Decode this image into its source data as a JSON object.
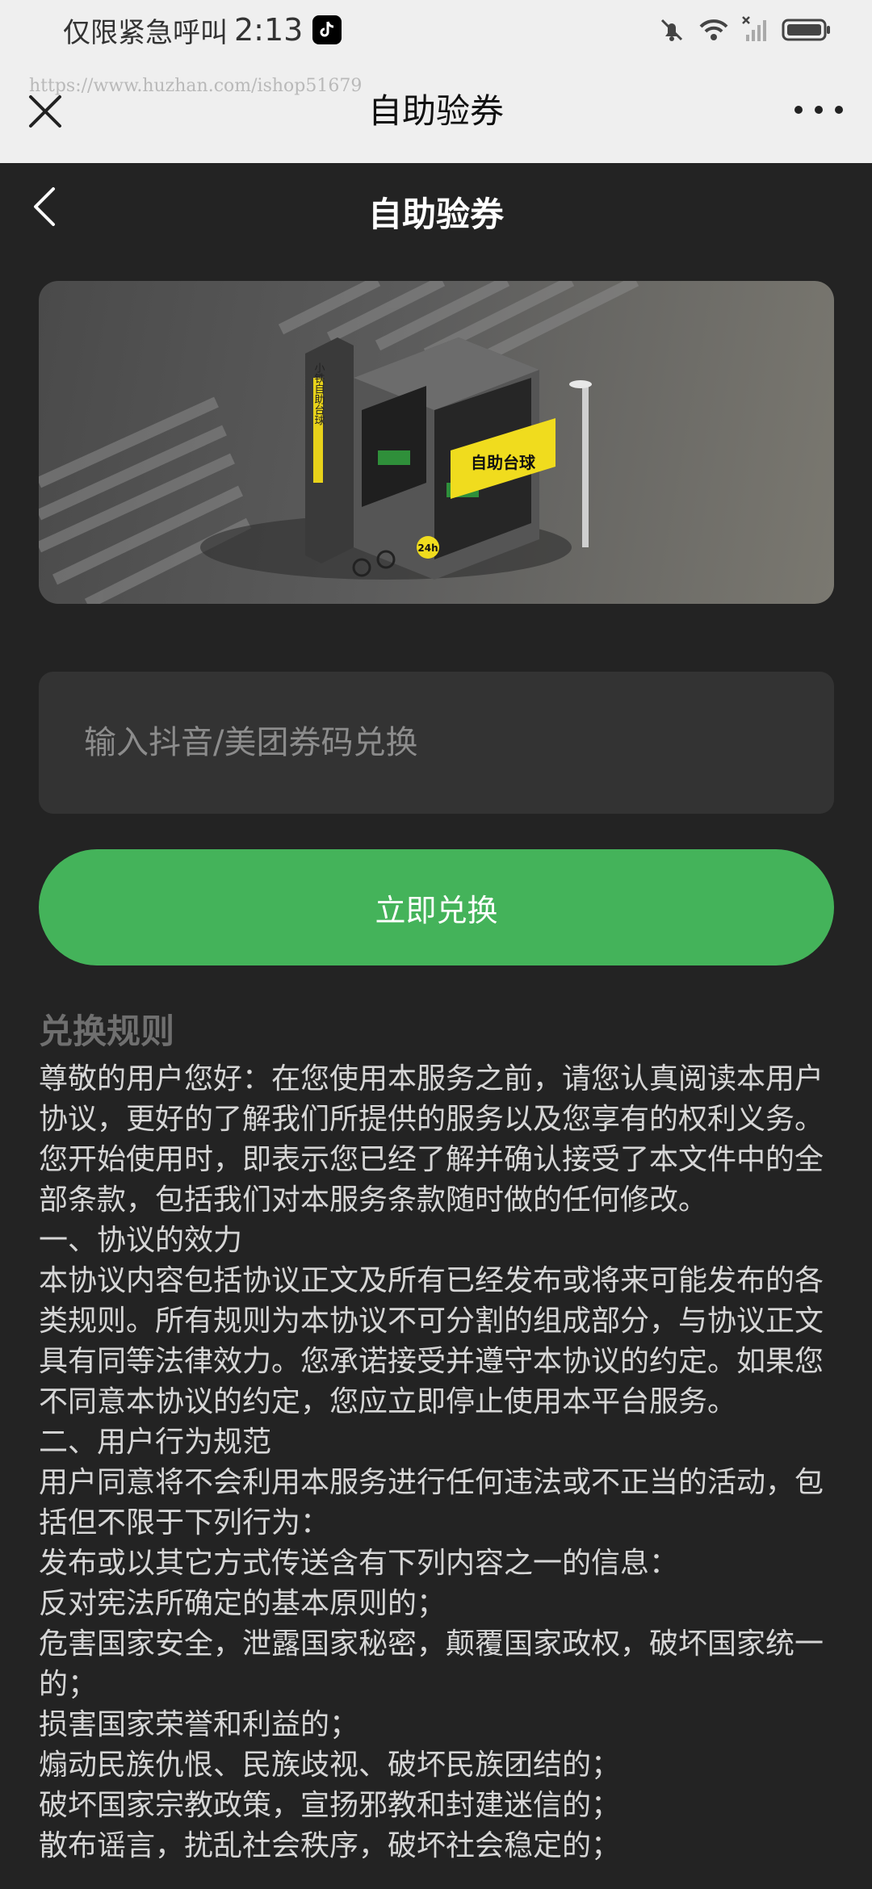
{
  "status_bar": {
    "carrier": "仅限紧急呼叫",
    "time": "2:13"
  },
  "wechat": {
    "watermark": "https://www.huzhan.com/ishop51679",
    "title": "自助验券"
  },
  "header": {
    "title": "自助验券"
  },
  "banner": {
    "sign_text": "自助台球",
    "vertical_text": "小铁自助台球",
    "badge_text": "24h"
  },
  "redeem": {
    "placeholder": "输入抖音/美团券码兑换",
    "button_label": "立即兑换"
  },
  "rules": {
    "title": "兑换规则",
    "lines": [
      "尊敬的用户您好：在您使用本服务之前，请您认真阅读本用户协议，更好的了解我们所提供的服务以及您享有的权利义务。您开始使用时，即表示您已经了解并确认接受了本文件中的全部条款，包括我们对本服务条款随时做的任何修改。",
      "一、协议的效力",
      "本协议内容包括协议正文及所有已经发布或将来可能发布的各类规则。所有规则为本协议不可分割的组成部分，与协议正文具有同等法律效力。您承诺接受并遵守本协议的约定。如果您不同意本协议的约定，您应立即停止使用本平台服务。",
      "二、用户行为规范",
      "用户同意将不会利用本服务进行任何违法或不正当的活动，包括但不限于下列行为：",
      "发布或以其它方式传送含有下列内容之一的信息：",
      "反对宪法所确定的基本原则的；",
      "危害国家安全，泄露国家秘密，颠覆国家政权，破坏国家统一的；",
      "损害国家荣誉和利益的；",
      "煽动民族仇恨、民族歧视、破坏民族团结的；",
      "破坏国家宗教政策，宣扬邪教和封建迷信的；",
      "散布谣言，扰乱社会秩序，破坏社会稳定的；"
    ]
  },
  "colors": {
    "background": "#232323",
    "accent_green": "#44b35a",
    "input_bg": "#333333"
  }
}
